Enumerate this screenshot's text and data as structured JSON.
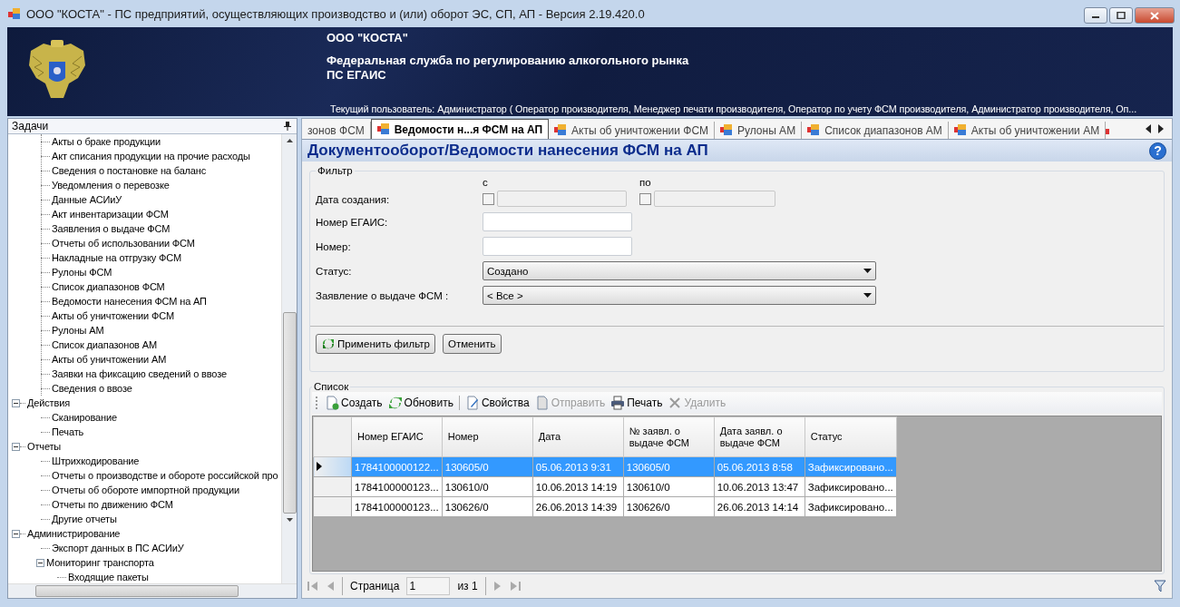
{
  "window": {
    "title": "ООО \"КОСТА\" - ПС предприятий, осуществляющих производство и (или) оборот ЭС, СП, АП - Версия 2.19.420.0"
  },
  "banner": {
    "company": "ООО \"КОСТА\"",
    "agency": "Федеральная служба по регулированию алкогольного рынка",
    "system": "ПС ЕГАИС",
    "user_line": "Текущий пользователь: Администратор ( Оператор производителя, Менеджер печати производителя, Оператор по учету ФСМ производителя, Администратор производителя, Оп..."
  },
  "sidebar": {
    "title": "Задачи",
    "continued_items": [
      "Акты о браке продукции",
      "Акт списания продукции на прочие расходы",
      "Сведения о постановке на баланс",
      "Уведомления о перевозке",
      "Данные АСИиУ",
      "Акт инвентаризации ФСМ",
      "Заявления о выдаче ФСМ",
      "Отчеты об использовании ФСМ",
      "Накладные на отгрузку ФСМ",
      "Рулоны ФСМ",
      "Список диапазонов ФСМ",
      "Ведомости нанесения ФСМ на АП",
      "Акты об уничтожении ФСМ",
      "Рулоны АМ",
      "Список диапазонов АМ",
      "Акты об уничтожении АМ",
      "Заявки на фиксацию сведений о ввозе",
      "Сведения о ввозе"
    ],
    "nodes": [
      {
        "label": "Действия",
        "expanded": true,
        "children": [
          {
            "label": "Сканирование"
          },
          {
            "label": "Печать"
          }
        ]
      },
      {
        "label": "Отчеты",
        "expanded": true,
        "children": [
          {
            "label": "Штрихкодирование"
          },
          {
            "label": "Отчеты о производстве и обороте российской про"
          },
          {
            "label": "Отчеты об обороте импортной продукции"
          },
          {
            "label": "Отчеты по движению ФСМ"
          },
          {
            "label": "Другие отчеты"
          }
        ]
      },
      {
        "label": "Администрирование",
        "expanded": true,
        "children": [
          {
            "label": "Экспорт данных в ПС АСИиУ"
          },
          {
            "label": "Мониторинг транспорта",
            "expanded": true,
            "children": [
              {
                "label": "Входящие пакеты"
              }
            ]
          }
        ]
      }
    ]
  },
  "tabs": [
    {
      "label": "зонов ФСМ",
      "selected": false
    },
    {
      "label": "Ведомости н...я ФСМ на АП",
      "selected": true
    },
    {
      "label": "Акты об уничтожении ФСМ",
      "selected": false
    },
    {
      "label": "Рулоны АМ",
      "selected": false
    },
    {
      "label": "Список диапазонов АМ",
      "selected": false
    },
    {
      "label": "Акты об уничтожении АМ",
      "selected": false
    }
  ],
  "page_title": "Документооборот/Ведомости нанесения ФСМ на АП",
  "help_glyph": "?",
  "filter": {
    "title": "Фильтр",
    "date_label": "Дата создания:",
    "from_label": "с",
    "to_label": "по",
    "from_checked": false,
    "to_checked": false,
    "egais_label": "Номер ЕГАИС:",
    "number_label": "Номер:",
    "status_label": "Статус:",
    "status_value": "Создано",
    "application_label": "Заявление о выдаче ФСМ :",
    "application_value": "< Все >",
    "apply_button": "Применить фильтр",
    "cancel_button": "Отменить"
  },
  "list": {
    "title": "Список",
    "toolbar": [
      {
        "label": "Создать",
        "kind": "create",
        "disabled": false
      },
      {
        "label": "Обновить",
        "kind": "refresh",
        "disabled": false
      },
      {
        "label": "Свойства",
        "kind": "properties",
        "disabled": false
      },
      {
        "label": "Отправить",
        "kind": "send",
        "disabled": true
      },
      {
        "label": "Печать",
        "kind": "print",
        "disabled": false
      },
      {
        "label": "Удалить",
        "kind": "delete",
        "disabled": true
      }
    ],
    "columns": [
      "Номер ЕГАИС",
      "Номер",
      "Дата",
      "№ заявл. о выдаче ФСМ",
      "Дата заявл. о выдаче ФСМ",
      "Статус"
    ],
    "rows": [
      {
        "selected": true,
        "cells": [
          "1784100000122...",
          "130605/0",
          "05.06.2013 9:31",
          "130605/0",
          "05.06.2013 8:58",
          "Зафиксировано..."
        ]
      },
      {
        "selected": false,
        "cells": [
          "1784100000123...",
          "130610/0",
          "10.06.2013 14:19",
          "130610/0",
          "10.06.2013 13:47",
          "Зафиксировано..."
        ]
      },
      {
        "selected": false,
        "cells": [
          "1784100000123...",
          "130626/0",
          "26.06.2013 14:39",
          "130626/0",
          "26.06.2013 14:14",
          "Зафиксировано..."
        ]
      }
    ]
  },
  "pager": {
    "page_label": "Страница",
    "page_value": "1",
    "of_label": "из",
    "total": "1"
  }
}
